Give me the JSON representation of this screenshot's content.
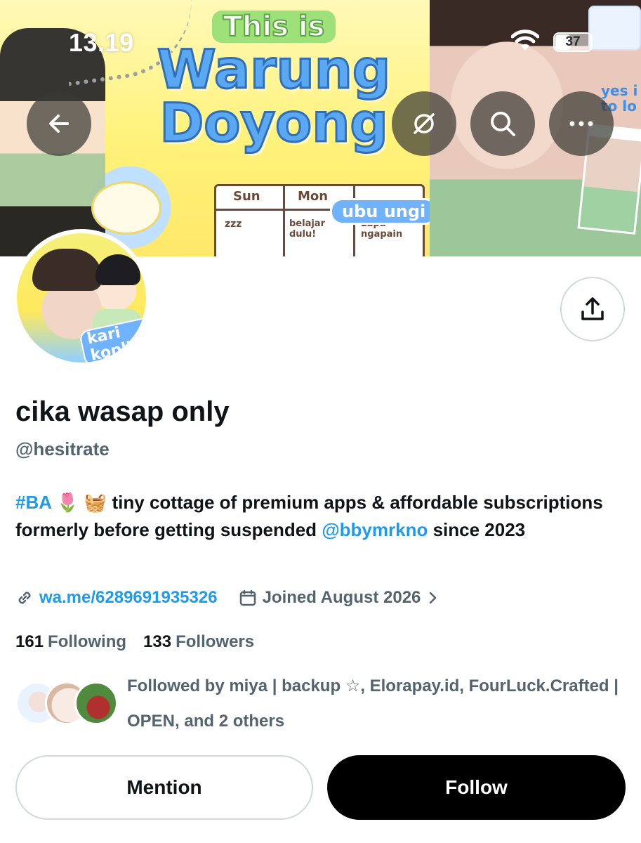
{
  "status_bar": {
    "time": "13.19",
    "battery": "37"
  },
  "banner": {
    "logo_small": "This is",
    "logo_line1": "Warung",
    "logo_line2": "Doyong",
    "schedule_sun": "Sun",
    "schedule_mon": "Mon",
    "schedule_z": "zzz",
    "schedule_note1": "belajar dulu!",
    "schedule_note2": "Lupa ngapain",
    "pill": "ubu ungi",
    "sticker_text": "yes i to lo"
  },
  "nav": {
    "back_icon": "arrow-left-icon",
    "grok_icon": "grok-icon",
    "search_icon": "search-icon",
    "more_icon": "more-horizontal-icon"
  },
  "avatar": {
    "badge": "kari kopling"
  },
  "profile": {
    "display_name": "cika wasap only",
    "handle": "@hesitrate",
    "bio_hashtag": "#BA",
    "bio_emoji": "🌷 🧺",
    "bio_text": "tiny cottage of premium apps & affordable subscriptions formerly before getting suspended",
    "bio_mention": "@bbymrkno",
    "bio_tail": "since 2023",
    "url": "wa.me/6289691935326",
    "joined": "Joined August 2026",
    "following_count": "161",
    "following_label": "Following",
    "followers_count": "133",
    "followers_label": "Followers",
    "followed_by": "Followed by miya | backup ☆, Elorapay.id, FourLuck.Crafted | OPEN, and 2 others"
  },
  "actions": {
    "mention": "Mention",
    "follow": "Follow"
  },
  "colors": {
    "accent": "#1d9bf0",
    "secondary_text": "#536471",
    "follow_bg": "#000000"
  }
}
